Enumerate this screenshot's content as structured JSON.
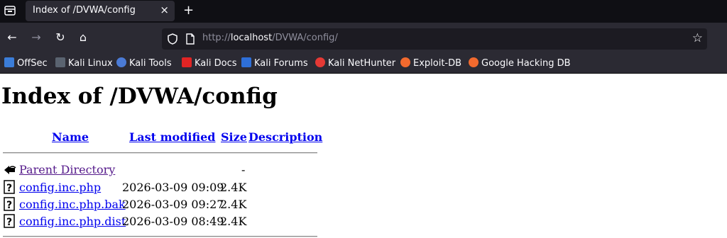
{
  "browser": {
    "tab_title": "Index of /DVWA/config",
    "tab_close": "×",
    "new_tab": "+",
    "url_proto": "http://",
    "url_host": "localhost",
    "url_path": "/DVWA/config/",
    "back": "←",
    "forward": "→",
    "reload": "↻",
    "home": "⌂",
    "star": "☆"
  },
  "bookmarks": [
    {
      "label": "OffSec",
      "icon": "offsec-icon",
      "color": "#3b7dd8"
    },
    {
      "label": "Kali Linux",
      "icon": "kali-dragon-icon",
      "color": "#cfd8e3"
    },
    {
      "label": "Kali Tools",
      "icon": "kali-tools-icon",
      "color": "#4b7bd6"
    },
    {
      "label": "Kali Docs",
      "icon": "kali-docs-icon",
      "color": "#e02424"
    },
    {
      "label": "Kali Forums",
      "icon": "kali-forums-icon",
      "color": "#2e6fd8"
    },
    {
      "label": "Kali NetHunter",
      "icon": "nethunter-icon",
      "color": "#e53935"
    },
    {
      "label": "Exploit-DB",
      "icon": "exploit-db-icon",
      "color": "#f26a2e"
    },
    {
      "label": "Google Hacking DB",
      "icon": "ghdb-icon",
      "color": "#f26a2e"
    }
  ],
  "page": {
    "title": "Index of /DVWA/config",
    "columns": {
      "name": "Name",
      "last_modified": "Last modified",
      "size": "Size",
      "description": "Description"
    },
    "rows": [
      {
        "name": "Parent Directory",
        "date": "",
        "size": "-",
        "icon": "back-folder-icon"
      },
      {
        "name": "config.inc.php",
        "date": "2026-03-09 09:09",
        "size": "2.4K",
        "icon": "unknown-file-icon"
      },
      {
        "name": "config.inc.php.bak",
        "date": "2026-03-09 09:27",
        "size": "2.4K",
        "icon": "unknown-file-icon"
      },
      {
        "name": "config.inc.php.dist",
        "date": "2026-03-09 08:49",
        "size": "2.4K",
        "icon": "unknown-file-icon"
      }
    ]
  }
}
